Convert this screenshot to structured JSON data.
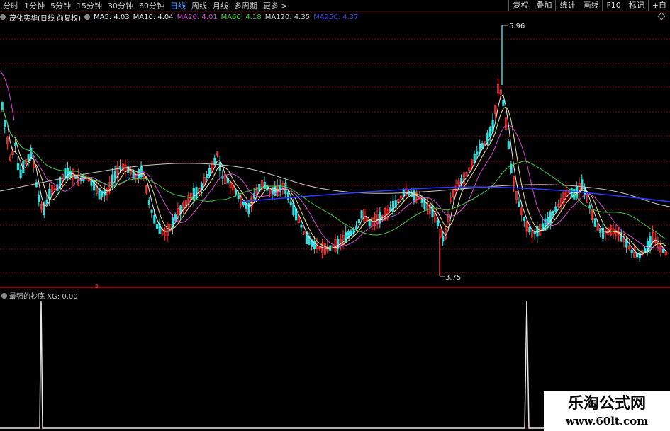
{
  "toolbar": {
    "tabs": [
      {
        "label": "分时"
      },
      {
        "label": "1分钟"
      },
      {
        "label": "5分钟"
      },
      {
        "label": "15分钟"
      },
      {
        "label": "30分钟"
      },
      {
        "label": "60分钟"
      },
      {
        "label": "日线",
        "active": true
      },
      {
        "label": "周线"
      },
      {
        "label": "月线"
      },
      {
        "label": "多周期"
      },
      {
        "label": "更多 >"
      }
    ],
    "tools": [
      "复权",
      "叠加",
      "统计",
      "画线",
      "F10",
      "标记",
      "+自"
    ]
  },
  "legend": {
    "title": "茂化实华(日线 前复权)",
    "items": [
      {
        "text": "MA5: 4.03",
        "color": "#e8e8e8"
      },
      {
        "text": "MA10: 4.04",
        "color": "#e8e8e8"
      },
      {
        "text": "MA20: 4.01",
        "color": "#d24bd2"
      },
      {
        "text": "MA60: 4.18",
        "color": "#45c845"
      },
      {
        "text": "MA120: 4.35",
        "color": "#c8c8c8"
      },
      {
        "text": "MA250: 4.37",
        "color": "#2a3cff"
      }
    ]
  },
  "price_labels": {
    "high": "5.96",
    "low": "3.75"
  },
  "marker": "8",
  "indicator": {
    "label": "最强的抄底 XG: 0.00"
  },
  "watermark": {
    "title": "乐淘公式网",
    "url": "www.60lt.com"
  },
  "colors": {
    "up": "#ff3232",
    "down": "#2fe0e0",
    "grid": "#8b0000",
    "separator": "#c00000"
  }
}
